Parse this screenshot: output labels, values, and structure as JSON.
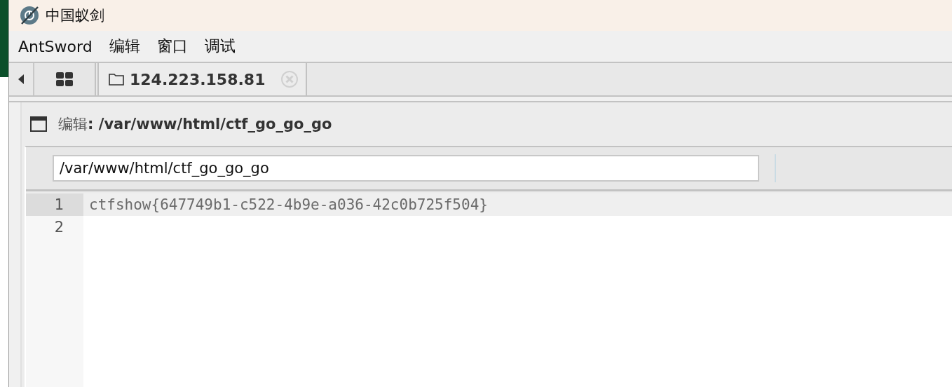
{
  "window": {
    "title": "中国蚁剑"
  },
  "menu": [
    "AntSword",
    "编辑",
    "窗口",
    "调试"
  ],
  "tabs": [
    {
      "kind": "grid",
      "selected": false
    },
    {
      "kind": "folder",
      "label": "124.223.158.81",
      "selected": true
    }
  ],
  "editor": {
    "title": "编辑**: /var/www/html/ctf_go_go_go**",
    "path": "/var/www/html/ctf_go_go_go",
    "lines": [
      {
        "number": "1",
        "text": "ctfshow{647749b1-c522-4b9e-a036-42c0b725f504}",
        "current": true
      },
      {
        "number": "2",
        "current": false
      }
    ]
  }
}
